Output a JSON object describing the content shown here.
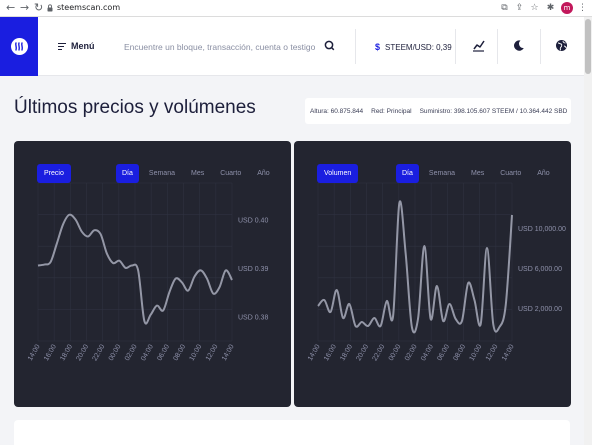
{
  "browser": {
    "url": "steemscan.com",
    "profile_initial": "m"
  },
  "header": {
    "menu_label": "Menú",
    "search_placeholder": "Encuentre un bloque, transacción, cuenta o testigo",
    "price_label": "STEEM/USD: 0,39",
    "price_symbol": "$",
    "icons": [
      "search-icon",
      "chart-icon",
      "moon-icon",
      "globe-icon"
    ]
  },
  "page": {
    "title": "Últimos precios y volúmenes",
    "stats": {
      "height": "Altura: 60.875.844",
      "network": "Red: Principal",
      "supply": "Suministro: 398.105.607 STEEM / 10.364.442 SBD"
    }
  },
  "price_panel": {
    "label": "Precio",
    "tabs": [
      "Día",
      "Semana",
      "Mes",
      "Cuarto",
      "Año"
    ],
    "active_tab": "Día"
  },
  "volume_panel": {
    "label": "Volumen",
    "tabs": [
      "Día",
      "Semana",
      "Mes",
      "Cuarto",
      "Año"
    ],
    "active_tab": "Día"
  },
  "colors": {
    "accent": "#1a1ee0",
    "panel_bg": "#232530",
    "line": "#9497a6",
    "grid": "#2f3240"
  },
  "chart_data": [
    {
      "type": "line",
      "title": "",
      "x": [
        "14:00",
        "16:00",
        "18:00",
        "20:00",
        "22:00",
        "00:00",
        "02:00",
        "04:00",
        "06:00",
        "08:00",
        "10:00",
        "12:00",
        "14:00"
      ],
      "ytick_labels": [
        "USD 0.40",
        "USD 0.39",
        "USD 0.38"
      ],
      "ytick_values": [
        0.4,
        0.39,
        0.38
      ],
      "ylim": [
        0.3755,
        0.4055
      ],
      "series": [
        {
          "values": [
            0.3905,
            0.3907,
            0.3912,
            0.395,
            0.399,
            0.401,
            0.4,
            0.3975,
            0.3965,
            0.3978,
            0.397,
            0.393,
            0.391,
            0.3915,
            0.39,
            0.3905,
            0.3895,
            0.379,
            0.3803,
            0.3822,
            0.3812,
            0.385,
            0.3878,
            0.387,
            0.3853,
            0.3882,
            0.3895,
            0.3878,
            0.3847,
            0.386,
            0.3895,
            0.3875
          ]
        }
      ]
    },
    {
      "type": "line",
      "title": "",
      "x": [
        "14:00",
        "16:00",
        "18:00",
        "20:00",
        "22:00",
        "00:00",
        "02:00",
        "04:00",
        "06:00",
        "08:00",
        "10:00",
        "12:00",
        "14:00"
      ],
      "ytick_labels": [
        "USD 10,000.00",
        "USD 6,000.00",
        "USD 2,000.00"
      ],
      "ytick_values": [
        10000,
        6000,
        2000
      ],
      "ylim": [
        -1000,
        13500
      ],
      "series": [
        {
          "values": [
            2200,
            2800,
            1600,
            3800,
            1000,
            2400,
            200,
            600,
            200,
            1000,
            200,
            2700,
            1200,
            12500,
            7500,
            100,
            1000,
            8200,
            900,
            4200,
            700,
            2400,
            900,
            700,
            4500,
            2800,
            400,
            8000,
            400,
            100,
            2300,
            11300
          ]
        }
      ]
    }
  ]
}
